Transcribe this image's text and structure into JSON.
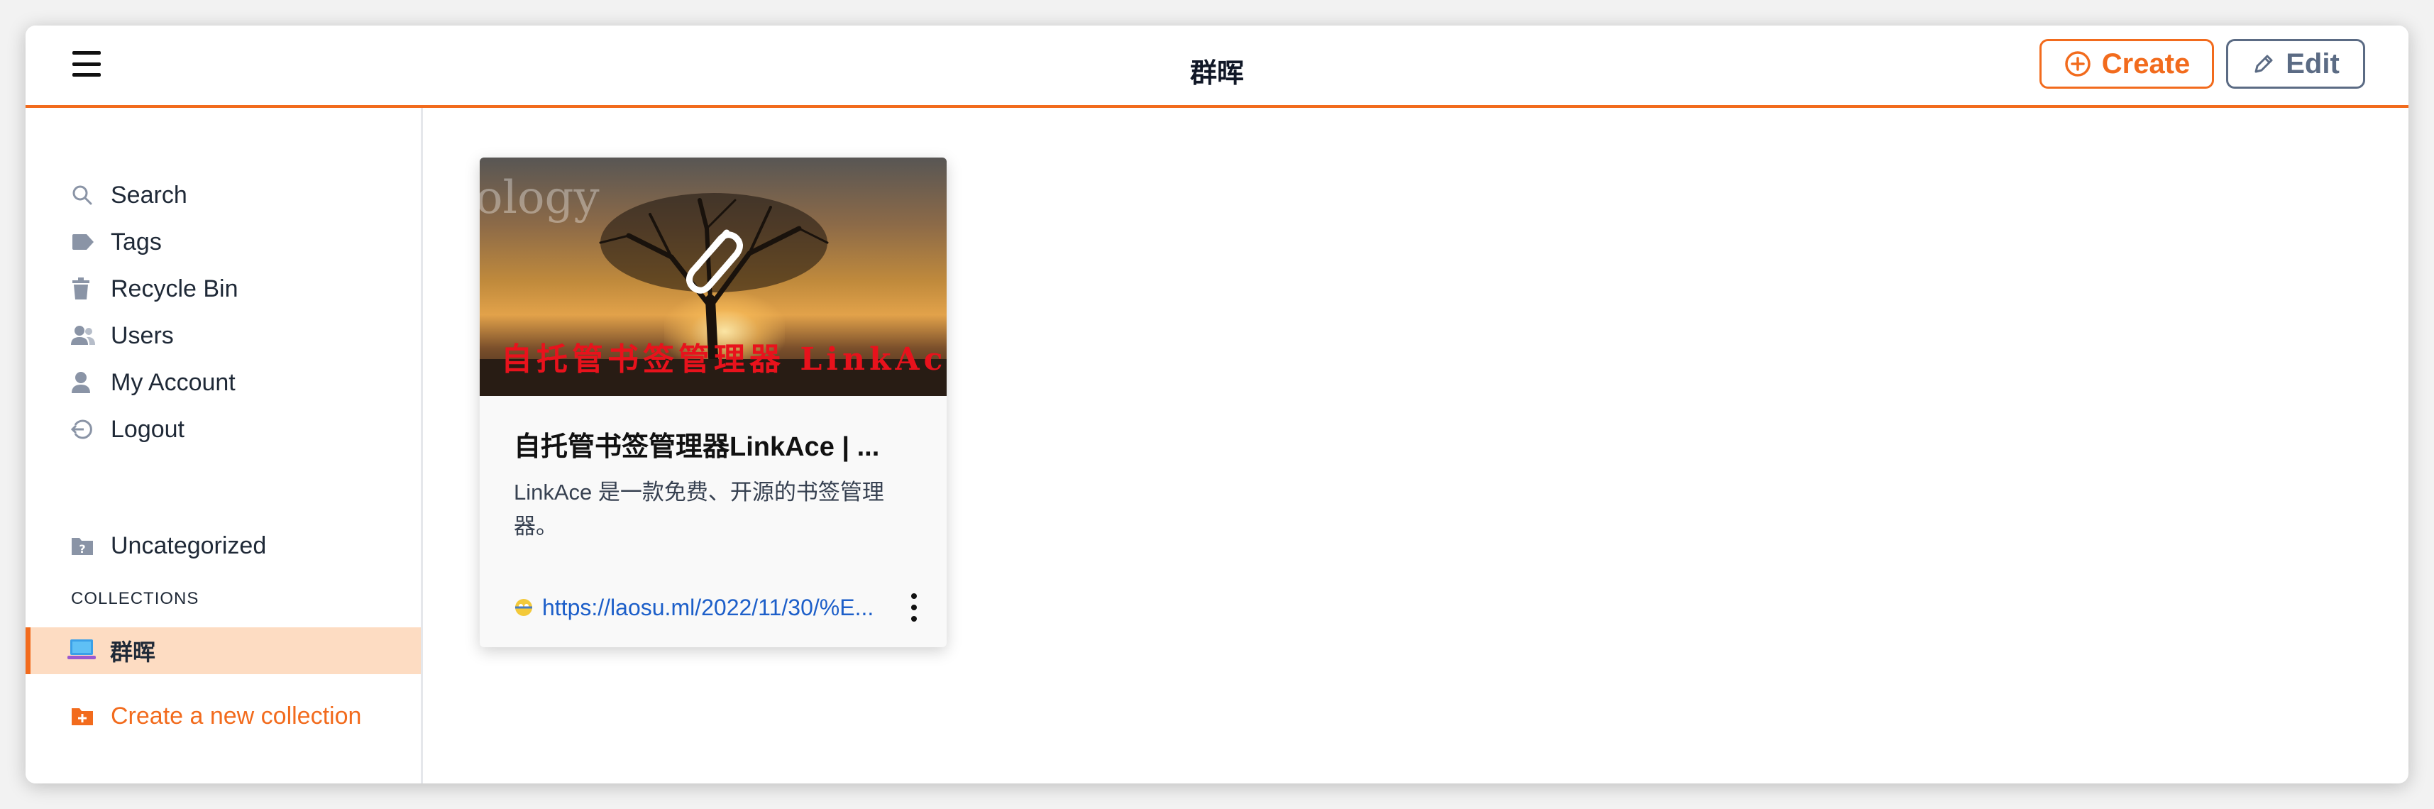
{
  "header": {
    "title": "群晖",
    "create_label": "Create",
    "edit_label": "Edit"
  },
  "sidebar": {
    "items": [
      {
        "label": "Search",
        "icon": "search-icon"
      },
      {
        "label": "Tags",
        "icon": "tag-icon"
      },
      {
        "label": "Recycle Bin",
        "icon": "trash-icon"
      },
      {
        "label": "Users",
        "icon": "users-icon"
      },
      {
        "label": "My Account",
        "icon": "user-icon"
      },
      {
        "label": "Logout",
        "icon": "logout-icon"
      }
    ],
    "uncategorized": {
      "label": "Uncategorized",
      "icon": "folder-question-icon"
    },
    "section_label": "COLLECTIONS",
    "active_collection": {
      "label": "群晖",
      "icon": "laptop-icon"
    },
    "create_collection_label": "Create a new collection"
  },
  "card": {
    "image_text": "自托管书签管理器 LinkAce",
    "image_faded_text": "ology",
    "title": "自托管书签管理器LinkAce | ...",
    "description": "LinkAce 是一款免费、开源的书签管理器。",
    "url": "https://laosu.ml/2022/11/30/%E...",
    "favicon": "site-favicon-icon"
  },
  "colors": {
    "accent": "#f26b1d",
    "edit": "#5b6b84",
    "active_bg": "#fddcc2",
    "link": "#1d5fc9"
  }
}
